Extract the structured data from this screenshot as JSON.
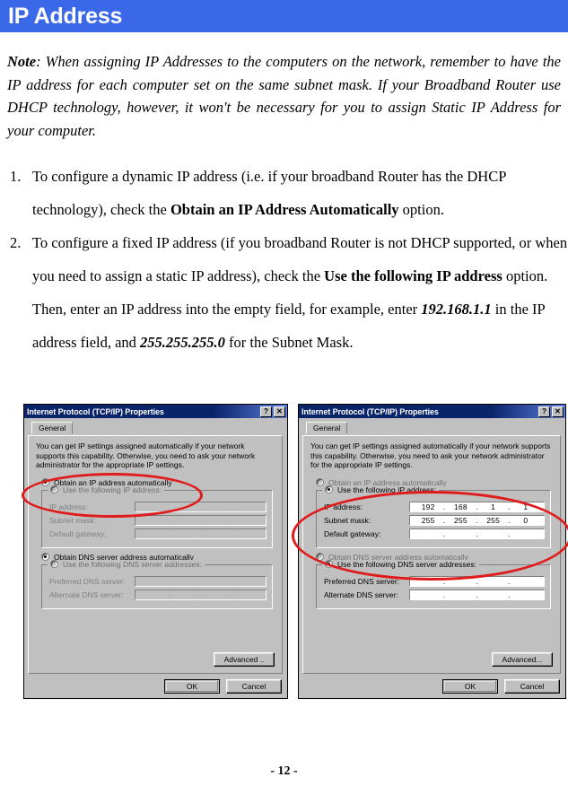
{
  "header": {
    "title": "IP Address"
  },
  "note": {
    "label": "Note",
    "text": ": When assigning IP Addresses to the computers on the network, remember to have the IP address for each computer set on the same subnet mask. If your Broadband Router use DHCP technology, however, it won't be necessary for you to assign Static IP Address for your computer."
  },
  "steps": [
    {
      "num": "1.",
      "parts": [
        {
          "t": "To configure a dynamic IP address (i.e. if your broadband Router has the DHCP technology), check the ",
          "style": "normal"
        },
        {
          "t": "Obtain an IP Address Automatically",
          "style": "bold"
        },
        {
          "t": " option.",
          "style": "normal"
        }
      ]
    },
    {
      "num": "2.",
      "parts": [
        {
          "t": "To configure a fixed IP address (if you broadband Router is not DHCP supported, or when you need to assign a static IP address), check the ",
          "style": "normal"
        },
        {
          "t": "Use the following IP address",
          "style": "bold"
        },
        {
          "t": " option. Then, enter an IP address into the empty field, for example, enter ",
          "style": "normal"
        },
        {
          "t": "192.168.1.1",
          "style": "bolditalic"
        },
        {
          "t": " in the IP address field, and ",
          "style": "normal"
        },
        {
          "t": "255.255.255.0",
          "style": "bolditalic"
        },
        {
          "t": " for the Subnet Mask.",
          "style": "normal"
        }
      ]
    }
  ],
  "dialog_left": {
    "title": "Internet Protocol (TCP/IP) Properties",
    "help_button": "?",
    "close_button": "✕",
    "tab": "General",
    "description": "You can get IP settings assigned automatically if your network supports this capability. Otherwise, you need to ask your network administrator for the appropriate IP settings.",
    "radio_obtain_ip": "Obtain an IP address automatically",
    "radio_obtain_ip_checked": true,
    "radio_static_ip": "Use the following IP address:",
    "radio_static_ip_checked": false,
    "ip_address_label": "IP address:",
    "ip_address_value": [
      "",
      "",
      "",
      ""
    ],
    "subnet_mask_label": "Subnet mask:",
    "subnet_mask_value": [
      "",
      "",
      "",
      ""
    ],
    "default_gateway_label": "Default gateway:",
    "default_gateway_value": [
      "",
      "",
      "",
      ""
    ],
    "radio_obtain_dns": "Obtain DNS server address automatically",
    "radio_obtain_dns_checked": true,
    "radio_static_dns": "Use the following DNS server addresses:",
    "radio_static_dns_checked": false,
    "preferred_dns_label": "Preferred DNS server:",
    "preferred_dns_value": [
      "",
      "",
      "",
      ""
    ],
    "alternate_dns_label": "Alternate DNS server:",
    "alternate_dns_value": [
      "",
      "",
      "",
      ""
    ],
    "advanced_button": "Advanced ..",
    "ok_button": "OK",
    "cancel_button": "Cancel"
  },
  "dialog_right": {
    "title": "Internet Protocol (TCP/IP) Properties",
    "help_button": "?",
    "close_button": "✕",
    "tab": "General",
    "description": "You can get IP settings assigned automatically if your network supports this capability. Otherwise, you need to ask your network administrator for the appropriate IP settings.",
    "radio_obtain_ip": "Obtain an IP address automatically",
    "radio_obtain_ip_checked": false,
    "radio_static_ip": "Use the following IP address:",
    "radio_static_ip_checked": true,
    "ip_address_label": "IP address:",
    "ip_address_value": [
      "192",
      "168",
      "1",
      "1"
    ],
    "subnet_mask_label": "Subnet mask:",
    "subnet_mask_value": [
      "255",
      "255",
      "255",
      "0"
    ],
    "default_gateway_label": "Default gateway:",
    "default_gateway_value": [
      "",
      "",
      "",
      ""
    ],
    "radio_obtain_dns": "Obtain DNS server address automatically",
    "radio_obtain_dns_checked": false,
    "radio_static_dns": "Use the following DNS server addresses:",
    "radio_static_dns_checked": true,
    "preferred_dns_label": "Preferred DNS server:",
    "preferred_dns_value": [
      "",
      "",
      "",
      ""
    ],
    "alternate_dns_label": "Alternate DNS server:",
    "alternate_dns_value": [
      "",
      "",
      "",
      ""
    ],
    "advanced_button": "Advanced...",
    "ok_button": "OK",
    "cancel_button": "Cancel"
  },
  "annotations": {
    "accent_color": "#E01B1B",
    "left_highlight": "Obtain an IP address automatically radio option",
    "right_highlight": "Use the following IP address group with IP address and Subnet mask fields"
  },
  "footer": {
    "page_number": "- 12 -"
  },
  "colors": {
    "banner": "#3B68E8",
    "dialog_face": "#C0C0C0",
    "titlebar": "#0A246A"
  }
}
